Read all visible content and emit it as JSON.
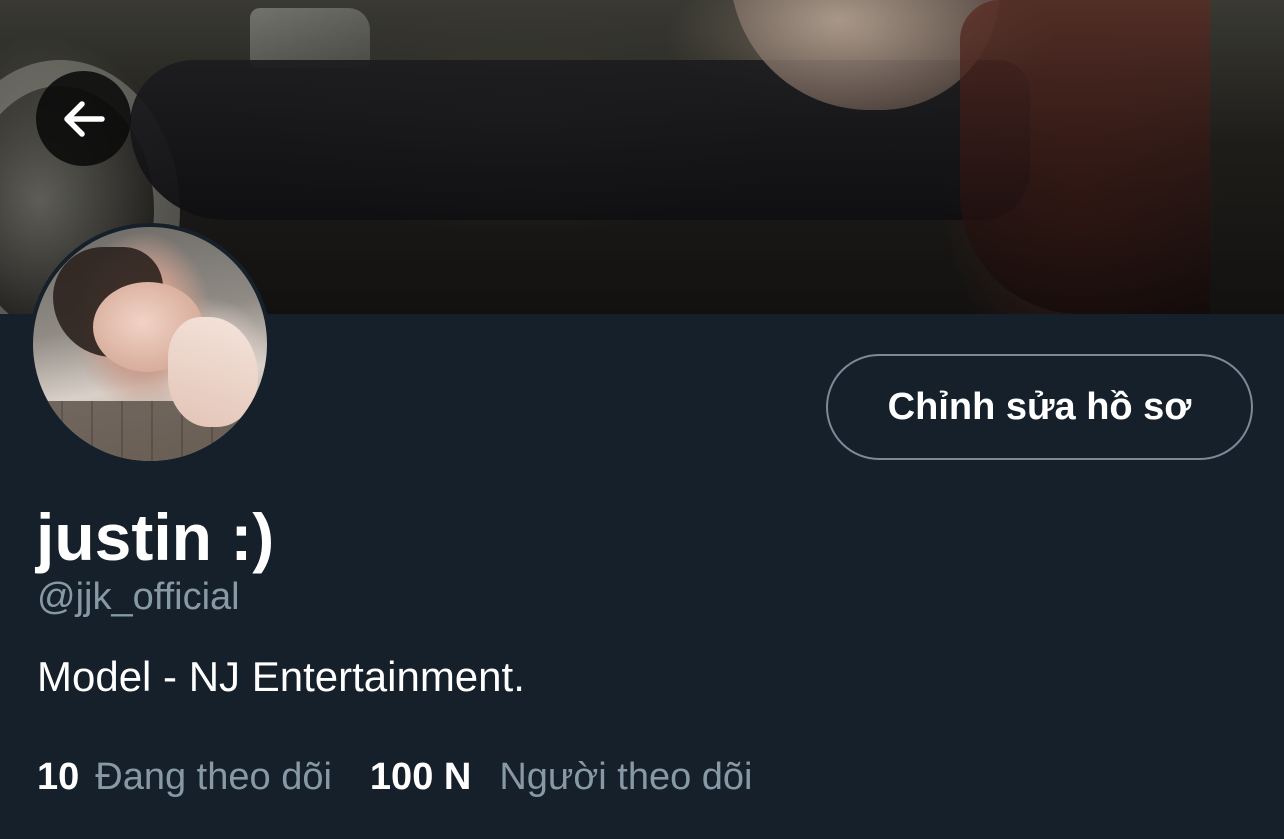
{
  "profile": {
    "display_name": "justin :)",
    "handle": "@jjk_official",
    "bio": "Model - NJ Entertainment."
  },
  "actions": {
    "edit_profile_label": "Chỉnh sửa hồ sơ"
  },
  "stats": {
    "following_count": "10",
    "following_label": "Đang theo dõi",
    "followers_count": "100 N",
    "followers_label": "Người theo dõi"
  },
  "icons": {
    "back": "arrow-left-icon"
  },
  "colors": {
    "background": "#15202b",
    "secondary_text": "#8899a6",
    "button_border": "#7b8a98",
    "primary_text": "#ffffff"
  }
}
